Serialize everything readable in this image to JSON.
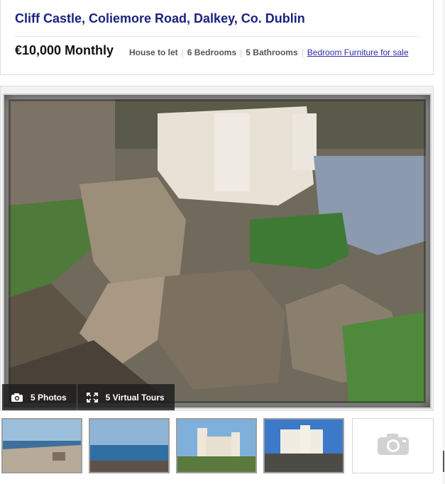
{
  "listing": {
    "title": "Cliff Castle, Coliemore Road, Dalkey, Co. Dublin",
    "price": "€10,000 Monthly",
    "property_type": "House to let",
    "bedrooms": "6 Bedrooms",
    "bathrooms": "5 Bathrooms",
    "related_link": "Bedroom Furniture for sale"
  },
  "gallery": {
    "photos_label": "5 Photos",
    "tours_label": "5 Virtual Tours",
    "photos_icon": "camera-icon",
    "tours_icon": "fullscreen-icon",
    "empty_thumb_icon": "camera-icon"
  },
  "colors": {
    "title": "#1a237e",
    "link": "#2c2ca8",
    "bar_background": "#1e1e1e"
  }
}
